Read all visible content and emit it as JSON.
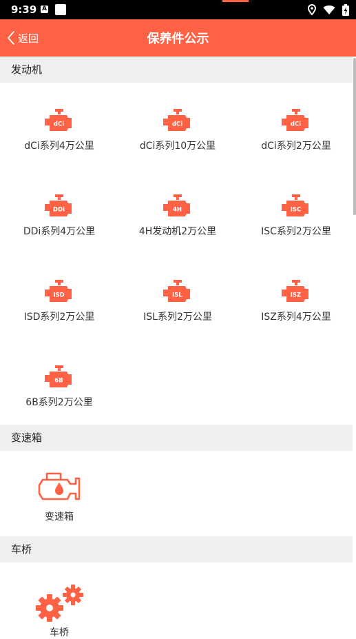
{
  "status_bar": {
    "time": "9:39",
    "left_icon_letter": "A"
  },
  "navbar": {
    "back_label": "返回",
    "title": "保养件公示",
    "background": "#ff6145"
  },
  "colors": {
    "accent": "#ff6145",
    "section_bg": "#efefef"
  },
  "sections": [
    {
      "title": "发动机",
      "items": [
        {
          "badge": "dCi",
          "label": "dCi系列4万公里",
          "icon": "engine-icon"
        },
        {
          "badge": "dCi",
          "label": "dCi系列10万公里",
          "icon": "engine-icon"
        },
        {
          "badge": "dCi",
          "label": "dCi系列2万公里",
          "icon": "engine-icon"
        },
        {
          "badge": "DDi",
          "label": "DDi系列4万公里",
          "icon": "engine-icon"
        },
        {
          "badge": "4H",
          "label": "4H发动机2万公里",
          "icon": "engine-icon"
        },
        {
          "badge": "ISC",
          "label": "ISC系列2万公里",
          "icon": "engine-icon"
        },
        {
          "badge": "ISD",
          "label": "ISD系列2万公里",
          "icon": "engine-icon"
        },
        {
          "badge": "ISL",
          "label": "ISL系列2万公里",
          "icon": "engine-icon"
        },
        {
          "badge": "ISZ",
          "label": "ISZ系列4万公里",
          "icon": "engine-icon"
        },
        {
          "badge": "6B",
          "label": "6B系列2万公里",
          "icon": "engine-icon"
        }
      ]
    },
    {
      "title": "变速箱",
      "items": [
        {
          "label": "变速箱",
          "icon": "transmission-oil-icon"
        }
      ]
    },
    {
      "title": "车桥",
      "items": [
        {
          "label": "车桥",
          "icon": "gears-icon"
        }
      ]
    }
  ]
}
